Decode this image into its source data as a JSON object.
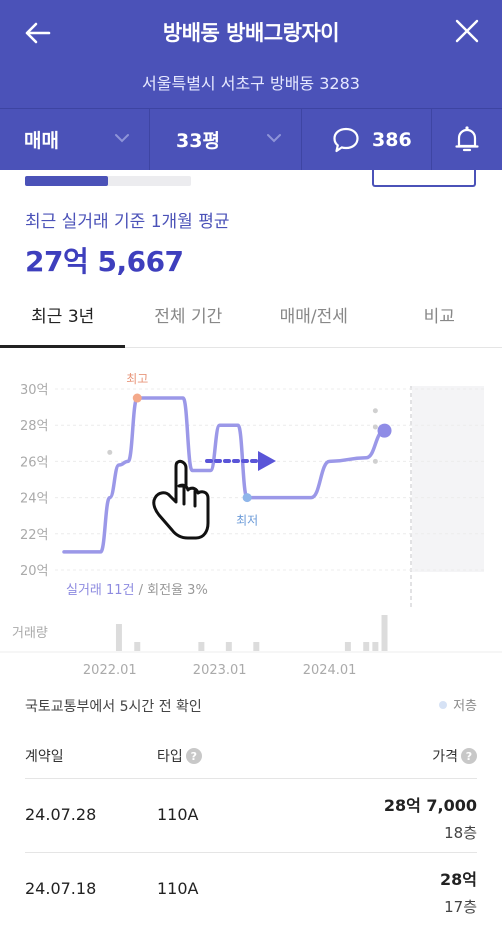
{
  "header": {
    "title": "방배동 방배그랑자이",
    "address": "서울특별시 서초구 방배동 3283"
  },
  "filters": {
    "trade_type": "매매",
    "size": "33평",
    "comment_count": "386"
  },
  "summary": {
    "progress": 0.5,
    "label": "최근 실거래 기준 1개월 평균",
    "value": "27억 5,667"
  },
  "tabs": [
    {
      "label": "최근 3년",
      "active": true
    },
    {
      "label": "전체 기간",
      "active": false
    },
    {
      "label": "매매/전세",
      "active": false
    },
    {
      "label": "비교",
      "active": false
    }
  ],
  "chart_data": {
    "type": "line",
    "y_tick_labels": [
      "30억",
      "28억",
      "26억",
      "24억",
      "22억",
      "20억"
    ],
    "ylim": [
      20,
      30
    ],
    "y_ticks": [
      30,
      28,
      26,
      24,
      22,
      20
    ],
    "x_tick_labels": [
      "2022.01",
      "2023.01",
      "2024.01"
    ],
    "x_tick_dates": [
      "2022-01",
      "2023-01",
      "2024-01"
    ],
    "xlim": [
      "2021-08",
      "2024-10"
    ],
    "series": [
      {
        "values": [
          [
            "2021-08",
            21.0
          ],
          [
            "2021-12",
            21.0
          ],
          [
            "2022-01",
            24.0
          ],
          [
            "2022-02",
            25.8
          ],
          [
            "2022-03",
            26.0
          ],
          [
            "2022-04",
            29.5
          ],
          [
            "2022-09",
            29.5
          ],
          [
            "2022-10",
            25.5
          ],
          [
            "2022-12",
            25.5
          ],
          [
            "2023-01",
            28.0
          ],
          [
            "2023-03",
            28.0
          ],
          [
            "2023-04",
            24.0
          ],
          [
            "2023-11",
            24.0
          ],
          [
            "2024-01",
            26.0
          ],
          [
            "2024-05",
            26.2
          ],
          [
            "2024-07",
            27.7
          ]
        ],
        "color": "#9b98e8"
      }
    ],
    "high_label": "최고",
    "high_point": [
      "2022-04",
      29.5
    ],
    "low_label": "최저",
    "low_point": [
      "2023-04",
      24.0
    ],
    "last_point": [
      "2024-07",
      27.7
    ],
    "extra_dots": [
      [
        "2022-01",
        26.5
      ],
      [
        "2024-06",
        28.8
      ],
      [
        "2024-06",
        27.9
      ],
      [
        "2024-06",
        26.0
      ]
    ],
    "volume_label": "거래량",
    "volume": [
      [
        "2022-02",
        3
      ],
      [
        "2022-04",
        1
      ],
      [
        "2022-11",
        1
      ],
      [
        "2023-02",
        1
      ],
      [
        "2023-05",
        1
      ],
      [
        "2024-03",
        1
      ],
      [
        "2024-05",
        1
      ],
      [
        "2024-06",
        1
      ],
      [
        "2024-07",
        4
      ]
    ],
    "footnote_main": "실거래 11건",
    "footnote_sub": " / 회전율 3%",
    "gesture_hint": "swipe"
  },
  "source": "국토교통부에서 5시간 전 확인",
  "legend_low": "저층",
  "table": {
    "headers": {
      "date": "계약일",
      "type": "타입",
      "price": "가격"
    },
    "help_icon": "?",
    "rows": [
      {
        "date": "24.07.28",
        "type": "110A",
        "price": "28억 7,000",
        "floor": "18층"
      },
      {
        "date": "24.07.18",
        "type": "110A",
        "price": "28억",
        "floor": "17층"
      }
    ]
  },
  "colors": {
    "brand": "#4b52b8",
    "accent_text": "#3e3fbd",
    "line": "#9b98e8",
    "high": "#f4a98a",
    "low": "#8fb6ea"
  }
}
